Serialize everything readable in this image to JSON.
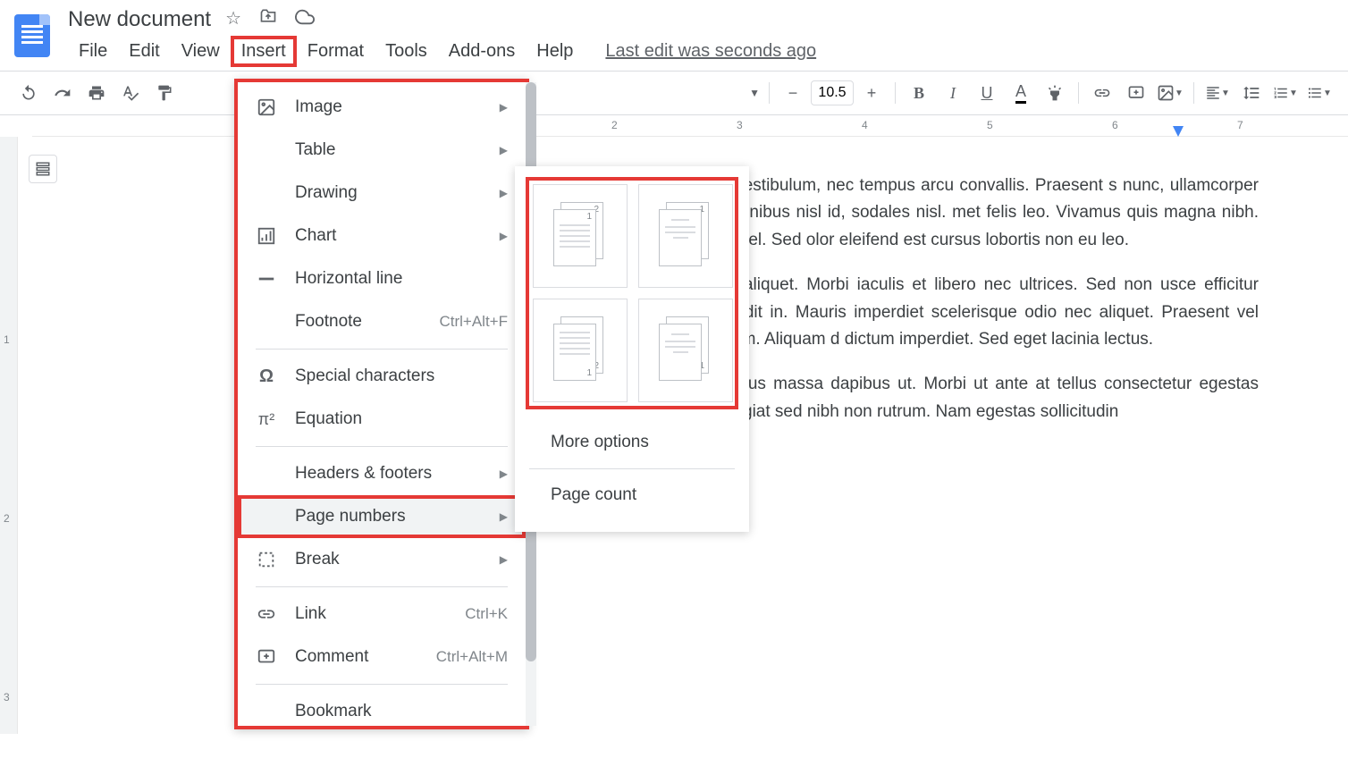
{
  "header": {
    "title": "New document"
  },
  "menu": {
    "file": "File",
    "edit": "Edit",
    "view": "View",
    "insert": "Insert",
    "format": "Format",
    "tools": "Tools",
    "addons": "Add-ons",
    "help": "Help",
    "last_edit": "Last edit was seconds ago"
  },
  "toolbar": {
    "font_size": "10.5"
  },
  "ruler": {
    "marks": [
      "2",
      "3",
      "4",
      "5",
      "6",
      "7"
    ]
  },
  "left_ruler": {
    "marks": [
      "1",
      "2",
      "3"
    ]
  },
  "insert_menu": {
    "image": "Image",
    "table": "Table",
    "drawing": "Drawing",
    "chart": "Chart",
    "horizontal_line": "Horizontal line",
    "footnote": "Footnote",
    "footnote_shortcut": "Ctrl+Alt+F",
    "special_characters": "Special characters",
    "equation": "Equation",
    "headers_footers": "Headers & footers",
    "page_numbers": "Page numbers",
    "break": "Break",
    "link": "Link",
    "link_shortcut": "Ctrl+K",
    "comment": "Comment",
    "comment_shortcut": "Ctrl+Alt+M",
    "bookmark": "Bookmark"
  },
  "submenu": {
    "more_options": "More options",
    "page_count": "Page count"
  },
  "document": {
    "para1": "iscing elit. Praesent rhoncus cursus magna blandit rci vestibulum, nec tempus arcu convallis. Praesent s nunc, ullamcorper pulvinar urna et, mollis euismod am ac nulla pharetra, finibus nisl id, sodales nisl. met felis leo. Vivamus quis magna nibh. Vestibulum rius varius tortor, at vehicula nulla vulputate vel. Sed olor eleifend est cursus lobortis non eu leo.",
    "para2": "i luctus et ultrices posuere cubilia curae; Vivamus ci aliquet. Morbi iaculis et libero nec ultrices. Sed non usce efficitur venenatis placerat. Vestibulum dapibus entum mi blandit in. Mauris imperdiet scelerisque odio nec aliquet. Praesent vel eleifend urna. Vivamus iaculis pharetra sem ut fermentum. Aliquam d dictum imperdiet. Sed eget lacinia lectus.",
    "para3": "m augue. Praesent malesuada vehicula dolor, sed luctus massa dapibus ut. Morbi ut ante at tellus consectetur egestas sagittis vel magna. Maecenas si in aliquam. Aliquam feugiat sed nibh non rutrum. Nam egestas sollicitudin"
  }
}
